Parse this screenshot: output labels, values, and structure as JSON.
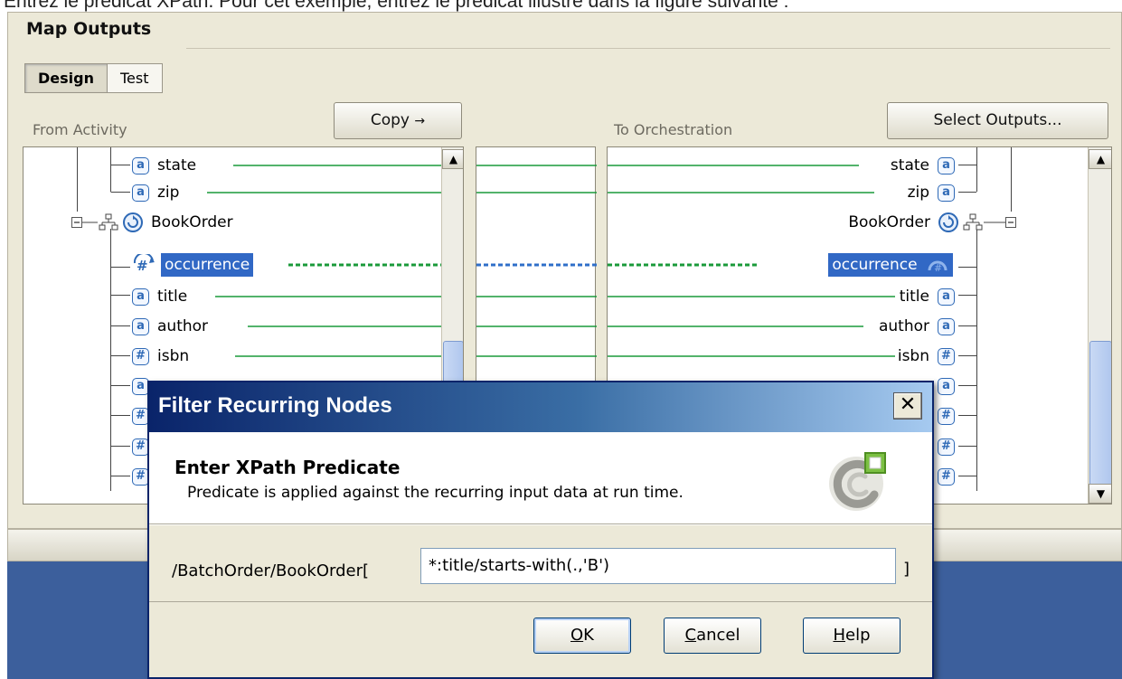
{
  "caption": "Entrez le prédicat XPath. Pour cet exemple, entrez le prédicat illustré dans la figure suivante :",
  "panel": {
    "title": "Map Outputs",
    "tabs": [
      {
        "label": "Design",
        "active": true
      },
      {
        "label": "Test",
        "active": false
      }
    ],
    "from_label": "From Activity",
    "to_label": "To Orchestration",
    "copy_button": "Copy",
    "copy_arrow": "→",
    "select_outputs_button": "Select Outputs..."
  },
  "left_tree": [
    {
      "label": "state",
      "icon": "a"
    },
    {
      "label": "zip",
      "icon": "a"
    },
    {
      "label": "BookOrder",
      "icon": "recurring-group"
    },
    {
      "label": "occurrence",
      "icon": "#",
      "selected": true
    },
    {
      "label": "title",
      "icon": "a"
    },
    {
      "label": "author",
      "icon": "a"
    },
    {
      "label": "isbn",
      "icon": "#"
    },
    {
      "label": "",
      "icon": "a"
    },
    {
      "label": "",
      "icon": "#"
    },
    {
      "label": "",
      "icon": "#"
    },
    {
      "label": "",
      "icon": "#"
    }
  ],
  "right_tree": [
    {
      "label": "state",
      "icon": "a"
    },
    {
      "label": "zip",
      "icon": "a"
    },
    {
      "label": "BookOrder",
      "icon": "recurring-group"
    },
    {
      "label": "occurrence",
      "icon": "#",
      "selected": true
    },
    {
      "label": "title",
      "icon": "a"
    },
    {
      "label": "author",
      "icon": "a"
    },
    {
      "label": "isbn",
      "icon": "#"
    },
    {
      "label": "",
      "icon": "a"
    },
    {
      "label": "",
      "icon": "#"
    },
    {
      "label": "",
      "icon": "#"
    },
    {
      "label": "",
      "icon": "#"
    }
  ],
  "dialog": {
    "title": "Filter Recurring Nodes",
    "close_label": "✕",
    "heading": "Enter XPath Predicate",
    "description": "Predicate is applied against the recurring input data at run time.",
    "predicate_prefix": "/BatchOrder/BookOrder[",
    "predicate_value": "*:title/starts-with(.,'B')",
    "predicate_suffix": "]",
    "ok_underlined": "O",
    "ok_rest": "K",
    "cancel_underlined": "C",
    "cancel_rest": "ancel",
    "help_underlined": "H",
    "help_rest": "elp"
  },
  "colors": {
    "map_line": "#1a9a3a",
    "map_dotted": "#1a9a3a",
    "selection": "#3168c5",
    "title_bar_start": "#0a246a",
    "title_bar_end": "#a6caf0"
  }
}
